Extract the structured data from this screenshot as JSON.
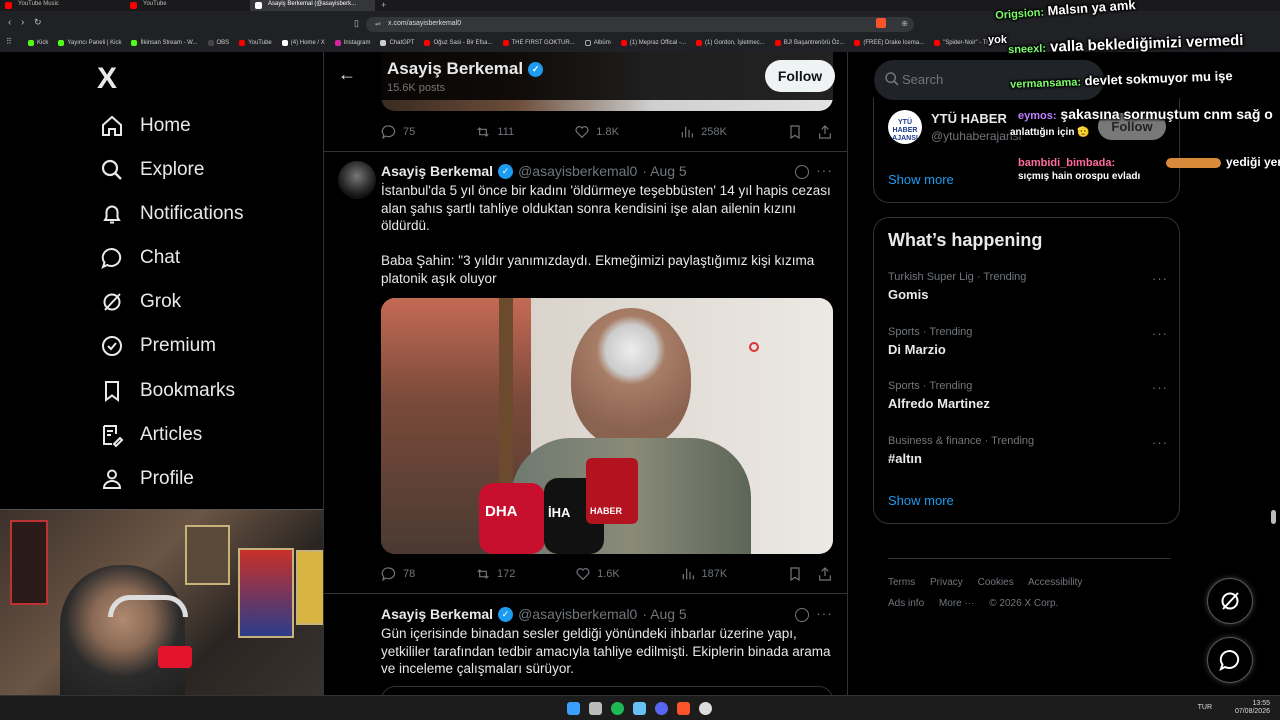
{
  "browser": {
    "tabs": [
      {
        "label": "YouTube Music",
        "color": "#ff0000"
      },
      {
        "label": "YouTube",
        "color": "#ff0000"
      },
      {
        "label": "Asayiş Berkemal (@asayisberk...",
        "color": "#ffffff",
        "active": true
      }
    ],
    "new_tab": "+",
    "url": "x.com/asayisberkemal0",
    "bookmarks": [
      "Kick",
      "Yayıncı Paneli | Kick",
      "İlkinsan Stream - W...",
      "OBS",
      "YouTube",
      "(4) Home / X",
      "Instagram",
      "ChatGPT",
      "Oğuz Sasi - Bir Efsa...",
      "THE FIRST GOKTUR...",
      "Albüm",
      "(1) Mepraz Offical -...",
      "(1) Gordon, İşletmec...",
      "BJ! Başantrenörü Öz...",
      "(FREE) Drake Icema...",
      "\"Spider-Noir\" - True..."
    ]
  },
  "sidebar": {
    "logo": "X",
    "items": [
      {
        "label": "Home",
        "icon": "home-icon"
      },
      {
        "label": "Explore",
        "icon": "search-icon"
      },
      {
        "label": "Notifications",
        "icon": "bell-icon"
      },
      {
        "label": "Chat",
        "icon": "chat-icon"
      },
      {
        "label": "Grok",
        "icon": "grok-icon"
      },
      {
        "label": "Premium",
        "icon": "premium-icon"
      },
      {
        "label": "Bookmarks",
        "icon": "bookmark-icon"
      },
      {
        "label": "Articles",
        "icon": "articles-icon"
      },
      {
        "label": "Profile",
        "icon": "profile-icon"
      }
    ]
  },
  "header": {
    "name": "Asayiş Berkemal",
    "posts": "15.6K posts",
    "follow": "Follow"
  },
  "prev_tweet": {
    "replies": "75",
    "reposts": "111",
    "likes": "1.8K",
    "views": "258K"
  },
  "tweets": [
    {
      "name": "Asayiş Berkemal",
      "handle": "@asayisberkemal0",
      "date": "· Aug 5",
      "text1": "İstanbul'da 5 yıl önce bir kadını 'öldürmeye teşebbüsten' 14 yıl hapis cezası alan şahıs şartlı tahliye olduktan sonra kendisini işe alan ailenin kızını öldürdü.",
      "text2": "Baba Şahin: \"3 yıldır yanımızdaydı. Ekmeğimizi paylaştığımız kişi kızıma platonik aşık oluyor",
      "mic_logos": [
        "DHA",
        "İHA",
        "HABER"
      ],
      "replies": "78",
      "reposts": "172",
      "likes": "1.6K",
      "views": "187K"
    },
    {
      "name": "Asayiş Berkemal",
      "handle": "@asayisberkemal0",
      "date": "· Aug 5",
      "text1": "Gün içerisinde binadan sesler geldiği yönündeki ihbarlar üzerine yapı, yetkililer tarafından tedbir amacıyla tahliye edilmişti. Ekiplerin binada arama ve inceleme çalışmaları sürüyor."
    }
  ],
  "right": {
    "search_placeholder": "Search",
    "suggest": {
      "logo": "YTÜ HABER AJANSI",
      "name": "YTÜ HABER",
      "handle": "@ytuhaberajansi",
      "follow": "Follow",
      "show_more": "Show more"
    },
    "happening": {
      "title": "What’s happening",
      "trends": [
        {
          "meta": "Turkish Super Lig · Trending",
          "name": "Gomis"
        },
        {
          "meta": "Sports · Trending",
          "name": "Di Marzio"
        },
        {
          "meta": "Sports · Trending",
          "name": "Alfredo Martinez"
        },
        {
          "meta": "Business & finance · Trending",
          "name": "#altın"
        }
      ],
      "show_more": "Show more"
    },
    "footer": [
      "Terms",
      "Privacy",
      "Cookies",
      "Accessibility",
      "Ads info",
      "More ···",
      "© 2026 X Corp."
    ]
  },
  "chat_overlay": [
    {
      "user": "Origsion:",
      "msg": "Malsın ya amk",
      "color": "#7cff6b"
    },
    {
      "user": "yok",
      "msg": "",
      "color": "#ffffff"
    },
    {
      "user": "sneexl:",
      "msg": "valla beklediğimizi vermedi",
      "color": "#7cff6b"
    },
    {
      "user": "vermansama:",
      "msg": "devlet sokmuyor mu işe",
      "color": "#7cff6b"
    },
    {
      "user": "eymos:",
      "msg": "şakasına sormuştum cnm sağ o",
      "color": "#c080ff"
    },
    {
      "user": "",
      "msg": "anlattığın için 🫡",
      "color": "#ffffff"
    },
    {
      "user": "bambidi_bimbada:",
      "msg": "yediği yere",
      "color": "#ff6b9a"
    },
    {
      "user": "",
      "msg": "sıçmış hain orospu evladı",
      "color": "#ffffff"
    }
  ],
  "taskbar": {
    "lang": "TUR",
    "time": "13:55",
    "date": "07/08/2026"
  },
  "colors": {
    "accent": "#1d9bf0",
    "background": "#000000",
    "border": "#2f3336",
    "muted": "#71767b"
  }
}
